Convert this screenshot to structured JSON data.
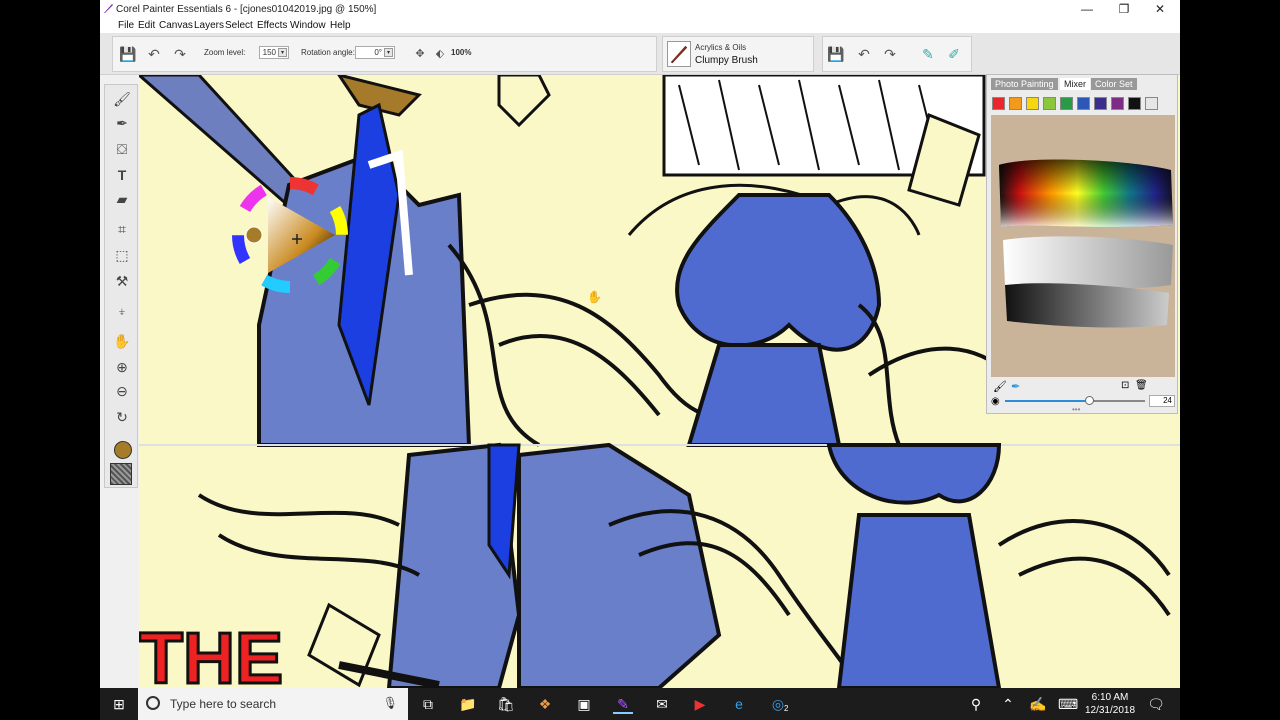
{
  "window": {
    "title": "Corel Painter Essentials 6 - [cjones01042019.jpg @ 150%]",
    "controls": {
      "minimize": "—",
      "maximize": "❐",
      "close": "✕"
    }
  },
  "menu": [
    "File",
    "Edit",
    "Canvas",
    "Layers",
    "Select",
    "Effects",
    "Window",
    "Help"
  ],
  "toolbar": {
    "zoom_label": "Zoom level:",
    "zoom_value": "150",
    "rotation_label": "Rotation angle:",
    "rotation_value": "0°",
    "zoom_percent": "100%",
    "brush_category": "Acrylics & Oils",
    "brush_variant": "Clumpy Brush"
  },
  "panel": {
    "tabs": [
      "Photo Painting",
      "Mixer",
      "Color Set"
    ],
    "active_tab": "Mixer",
    "swatches": [
      "#e8262b",
      "#f39a1d",
      "#f5d60f",
      "#8cc63f",
      "#2a9a47",
      "#2e58b7",
      "#3a2e8c",
      "#7d2d84",
      "#111111",
      "#f2ef8a",
      "#e6e6e6",
      "#ffffff"
    ],
    "brush_size": "24"
  },
  "colors": {
    "current_color": "#a67c28",
    "canvas_bg": "#fbf8c8",
    "suit_blue": "#6a7fc9",
    "tie_blue": "#1b3fe0"
  },
  "taskbar": {
    "search_placeholder": "Type here to search",
    "time": "6:10 AM",
    "date": "12/31/2018",
    "notification_count": "2"
  }
}
